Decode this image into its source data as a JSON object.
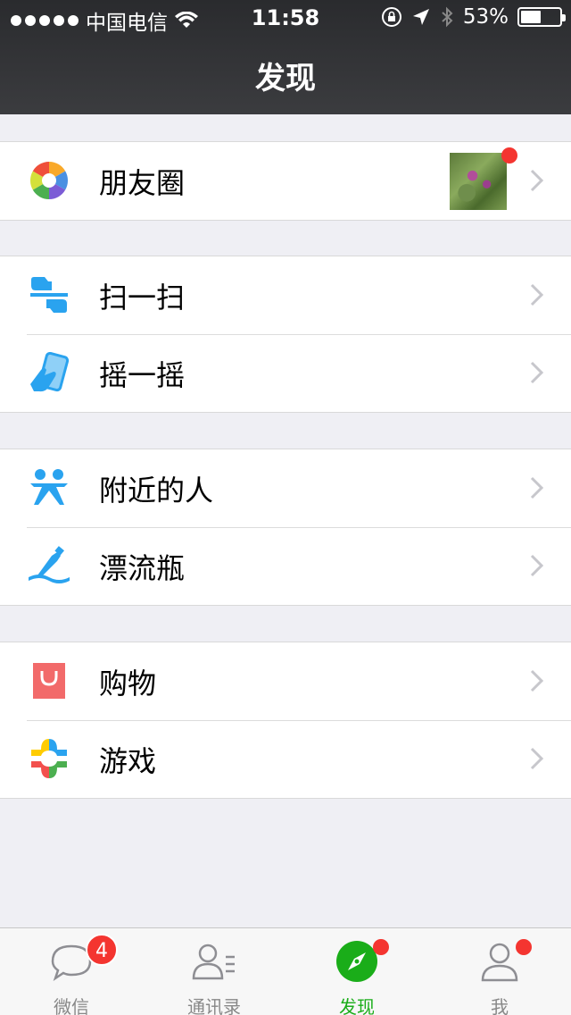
{
  "status_bar": {
    "carrier": "中国电信",
    "time": "11:58",
    "battery": "53%",
    "battery_level": 0.53
  },
  "header": {
    "title": "发现"
  },
  "groups": [
    {
      "items": [
        {
          "label": "朋友圈",
          "icon": "moments-icon",
          "has_thumbnail": true,
          "has_dot": true
        }
      ]
    },
    {
      "items": [
        {
          "label": "扫一扫",
          "icon": "scan-icon"
        },
        {
          "label": "摇一摇",
          "icon": "shake-icon"
        }
      ]
    },
    {
      "items": [
        {
          "label": "附近的人",
          "icon": "people-nearby-icon"
        },
        {
          "label": "漂流瓶",
          "icon": "drift-bottle-icon"
        }
      ]
    },
    {
      "items": [
        {
          "label": "购物",
          "icon": "shopping-icon"
        },
        {
          "label": "游戏",
          "icon": "games-icon"
        }
      ]
    }
  ],
  "tabbar": {
    "tabs": [
      {
        "label": "微信",
        "icon": "chat-icon",
        "badge": "4"
      },
      {
        "label": "通讯录",
        "icon": "contacts-icon"
      },
      {
        "label": "发现",
        "icon": "compass-icon",
        "active": true,
        "dot": true
      },
      {
        "label": "我",
        "icon": "me-icon",
        "dot": true
      }
    ]
  },
  "colors": {
    "accent": "#1aad19",
    "badge": "#f43530",
    "header": "#2f3033",
    "background": "#efeff4"
  }
}
